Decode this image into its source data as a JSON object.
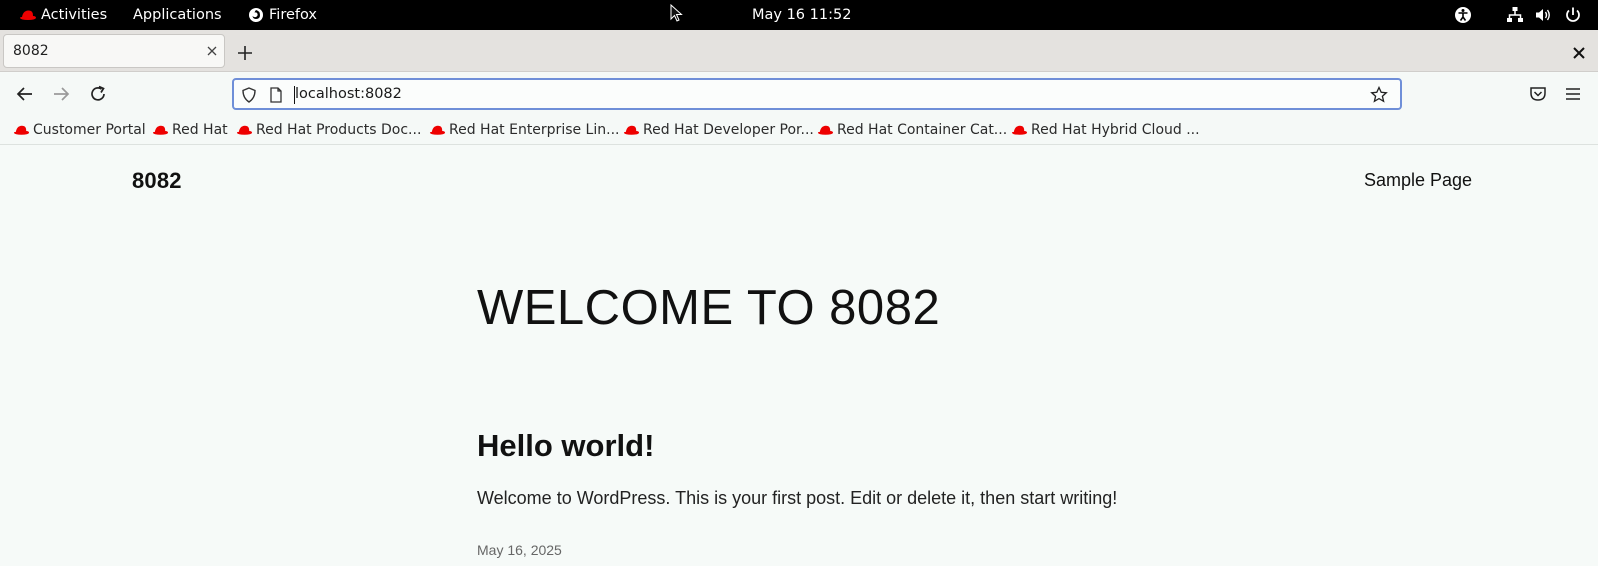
{
  "system_bar": {
    "activities": "Activities",
    "applications": "Applications",
    "firefox_label": "Firefox",
    "clock": "May 16  11:52"
  },
  "browser": {
    "tab_title": "8082",
    "url": "localhost:8082",
    "bookmarks": [
      "Customer Portal",
      "Red Hat",
      "Red Hat Products Doc...",
      "Red Hat Enterprise Lin...",
      "Red Hat Developer Por...",
      "Red Hat Container Cat...",
      "Red Hat Hybrid Cloud ..."
    ]
  },
  "page": {
    "site_title": "8082",
    "nav_link": "Sample Page",
    "heading": "WELCOME TO 8082",
    "post": {
      "title": "Hello world!",
      "excerpt": "Welcome to WordPress. This is your first post. Edit or delete it, then start writing!",
      "date": "May 16, 2025"
    }
  },
  "colors": {
    "redhat_red": "#ee0000",
    "url_focus": "#6f8fd8",
    "page_background": "#f6faf8"
  }
}
